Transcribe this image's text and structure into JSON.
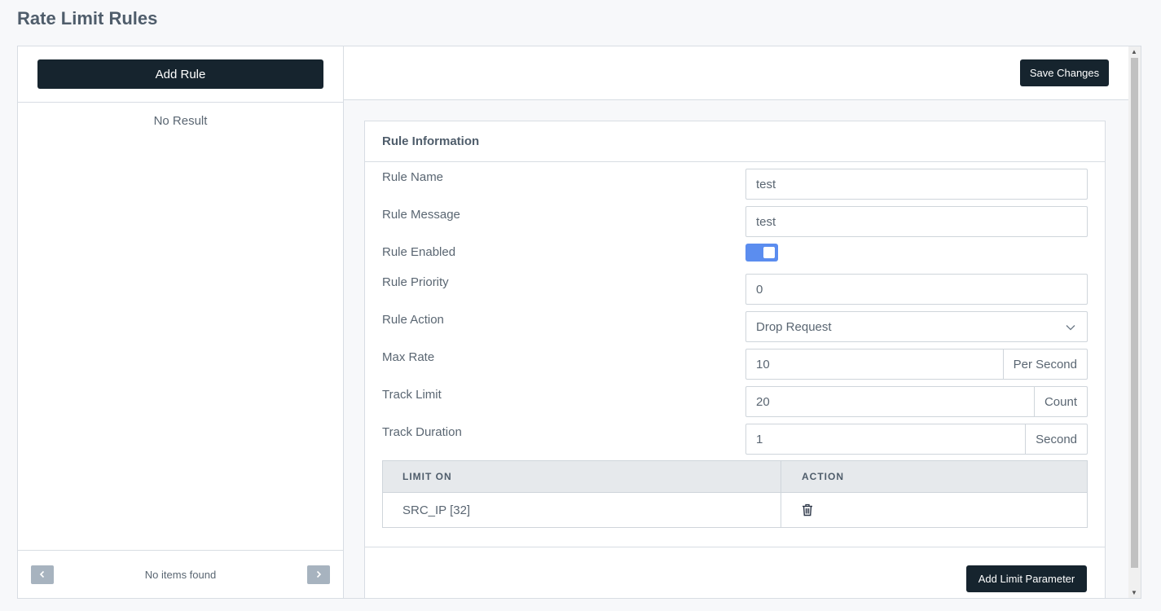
{
  "page": {
    "title": "Rate Limit Rules"
  },
  "left": {
    "add_rule_label": "Add Rule",
    "empty_text": "No Result",
    "pager": {
      "prev_icon": "chevron-left",
      "next_icon": "chevron-right",
      "status": "No items found"
    }
  },
  "toolbar": {
    "save_label": "Save Changes"
  },
  "card": {
    "title": "Rule Information",
    "fields": {
      "rule_name": {
        "label": "Rule Name",
        "value": "test"
      },
      "rule_message": {
        "label": "Rule Message",
        "value": "test"
      },
      "rule_enabled": {
        "label": "Rule Enabled",
        "value": true
      },
      "rule_priority": {
        "label": "Rule Priority",
        "value": "0"
      },
      "rule_action": {
        "label": "Rule Action",
        "value": "Drop Request"
      },
      "max_rate": {
        "label": "Max Rate",
        "value": "10",
        "unit": "Per Second"
      },
      "track_limit": {
        "label": "Track Limit",
        "value": "20",
        "unit": "Count"
      },
      "track_duration": {
        "label": "Track Duration",
        "value": "1",
        "unit": "Second"
      }
    },
    "table": {
      "headers": [
        "LIMIT ON",
        "ACTION"
      ],
      "rows": [
        {
          "limit_on": "SRC_IP [32]",
          "action_icon": "trash-icon"
        }
      ]
    },
    "add_limit_label": "Add Limit Parameter"
  },
  "colors": {
    "primary_dark": "#16242e",
    "toggle_on": "#5b8def"
  }
}
